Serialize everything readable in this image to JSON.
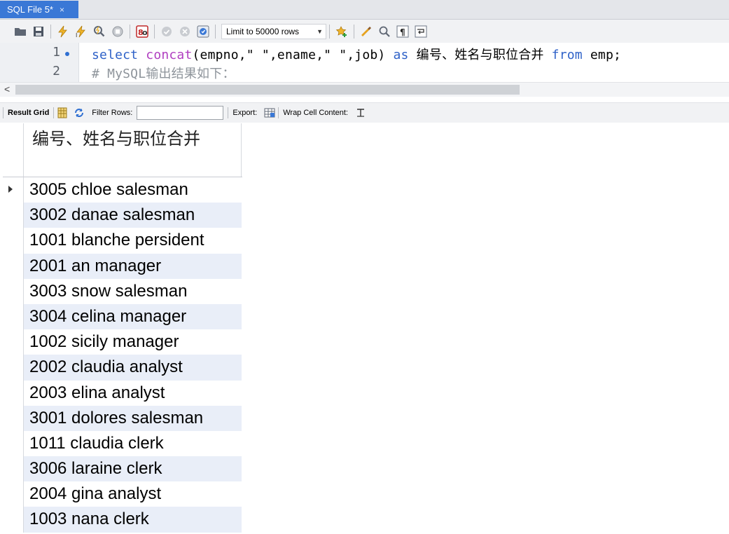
{
  "tab": {
    "title": "SQL File 5*",
    "close": "×"
  },
  "toolbar": {
    "icons": [
      "folder-icon",
      "save-icon",
      "execute-icon",
      "execute-current-icon",
      "explain-icon",
      "stop-icon",
      "toggle-error-icon",
      "commit-icon",
      "rollback-icon",
      "autocommit-icon",
      "add-snippet-icon",
      "beautify-icon",
      "find-icon",
      "invisibles-icon",
      "wrap-icon"
    ],
    "limit_label": "Limit to 50000 rows"
  },
  "editor": {
    "lines": [
      {
        "number": "1",
        "has_marker": true
      },
      {
        "number": "2",
        "has_marker": false
      }
    ],
    "line1": {
      "kw_select": "select",
      "fn_concat": "concat",
      "args": "(empno,\" \",ename,\" \",job)",
      "kw_as": "as",
      "alias": "编号、姓名与职位合并",
      "kw_from": "from",
      "table": "emp;"
    },
    "line2_comment": "# MySQL输出结果如下："
  },
  "scrollbar": {
    "left_arrow": "<"
  },
  "result_toolbar": {
    "result_grid": "Result Grid",
    "filter_rows": "Filter Rows:",
    "filter_value": "",
    "export": "Export:",
    "wrap": "Wrap Cell Content:"
  },
  "grid": {
    "column_header": "编号、姓名与职位合并",
    "rows": [
      "3005 chloe salesman",
      "3002 danae salesman",
      "1001 blanche persident",
      "2001 an manager",
      "3003 snow salesman",
      "3004 celina manager",
      "1002 sicily manager",
      "2002 claudia analyst",
      "2003 elina analyst",
      "3001 dolores salesman",
      "1011 claudia clerk",
      "3006 laraine clerk",
      "2004 gina analyst",
      "1003 nana clerk"
    ]
  }
}
